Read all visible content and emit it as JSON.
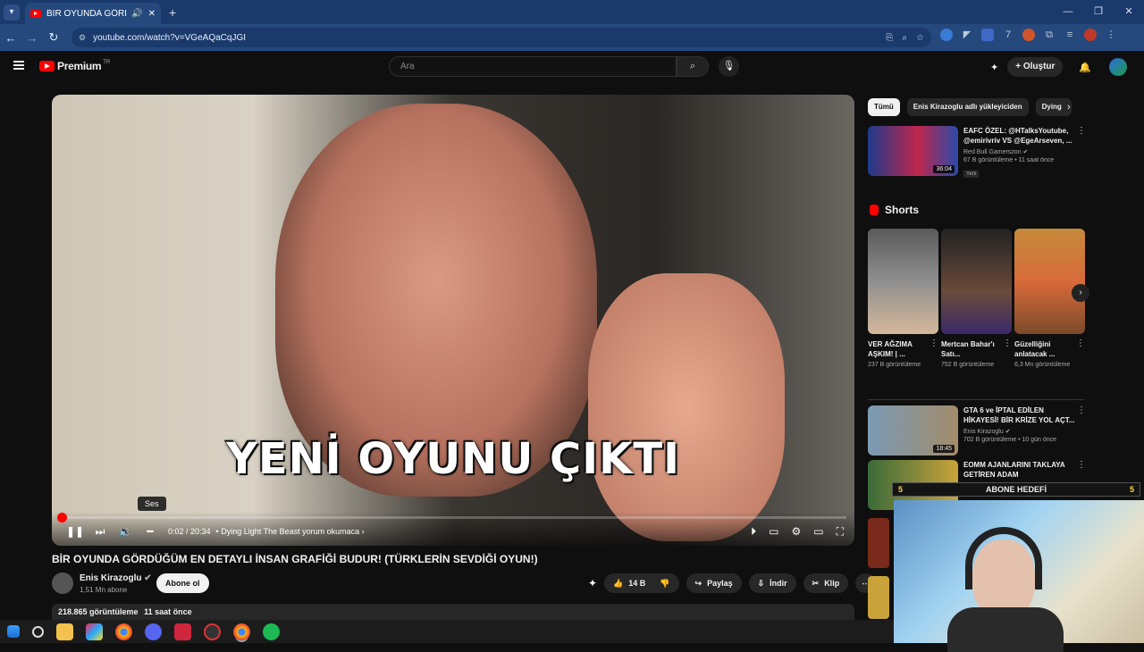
{
  "browser": {
    "tab_title": "BİR OYUNDA GÖRDÜĞÜM",
    "url": "youtube.com/watch?v=VGeAQaCqJGI"
  },
  "header": {
    "brand": "Premium",
    "brand_suffix": "TR",
    "search_placeholder": "Ara",
    "create_label": "Oluştur"
  },
  "player": {
    "caption": "YENİ OYUNU ÇIKTI",
    "tooltip": "Ses",
    "time": "0:02 / 20:34",
    "chapter": "Dying Light The Beast yorum okumaca",
    "progress": 0.002
  },
  "video": {
    "title": "BİR OYUNDA GÖRDÜĞÜM EN DETAYLI İNSAN GRAFİĞİ BUDUR! (TÜRKLERİN SEVDİĞİ OYUN!)",
    "channel": "Enis Kirazoglu",
    "subs": "1,51 Mn abone",
    "subscribe_label": "Abone ol",
    "likes": "14 B",
    "share_label": "Paylaş",
    "download_label": "İndir",
    "clip_label": "Klip",
    "views": "218.865 görüntüleme",
    "age": "11 saat önce"
  },
  "sidebar": {
    "chips": [
      "Tümü",
      "Enis Kirazoglu adlı yükleyiciden",
      "Dying"
    ],
    "rec1": {
      "title": "EAFC ÖZEL: @HTalksYoutube, @emirivriv VS @EgeArseven, ...",
      "channel": "Red Bull Gamerszon",
      "stats": "67 B görüntüleme • 11 saat önce",
      "badge": "Yeni",
      "duration": "36:04"
    },
    "shorts_title": "Shorts",
    "shorts": [
      {
        "title": "VER AĞZIMA AŞKIM! | ...",
        "views": "237 B görüntüleme"
      },
      {
        "title": "Mertcan Bahar'ı Satı...",
        "views": "752 B görüntüleme"
      },
      {
        "title": "Güzelliğini anlatacak ...",
        "views": "6,3 Mn görüntüleme"
      }
    ],
    "rec2": {
      "title": "GTA 6 ve İPTAL EDİLEN HİKAYESİ! BİR KRİZE YOL AÇT...",
      "channel": "Enis Kirazoglu",
      "stats": "702 B görüntüleme • 10 gün önce",
      "duration": "18:45"
    },
    "rec3": {
      "title": "EOMM AJANLARINI TAKLAYA GETİREN ADAM"
    }
  },
  "overlay": {
    "goal_label": "ABONE HEDEFİ",
    "goal_left": "5",
    "goal_right": "5"
  }
}
